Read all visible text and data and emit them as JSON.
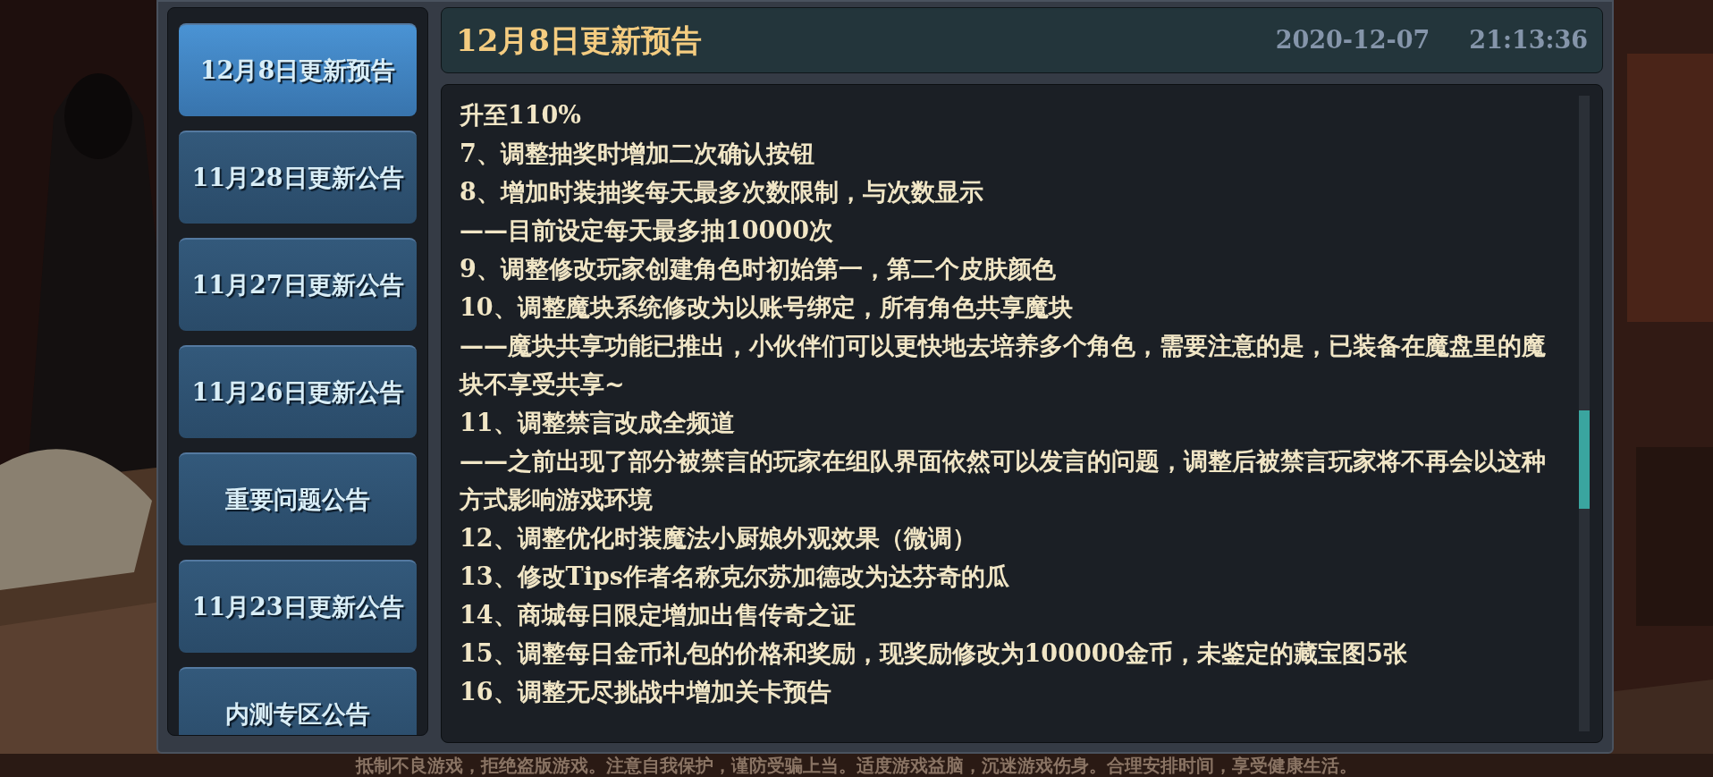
{
  "sidebar": {
    "items": [
      {
        "label": "12月8日更新预告",
        "selected": true
      },
      {
        "label": "11月28日更新公告",
        "selected": false
      },
      {
        "label": "11月27日更新公告",
        "selected": false
      },
      {
        "label": "11月26日更新公告",
        "selected": false
      },
      {
        "label": "重要问题公告",
        "selected": false
      },
      {
        "label": "11月23日更新公告",
        "selected": false
      },
      {
        "label": "内测专区公告",
        "selected": false
      }
    ]
  },
  "header": {
    "title": "12月8日更新预告",
    "date": "2020-12-07",
    "time": "21:13:36"
  },
  "content": {
    "lines": [
      "升至110%",
      "7、调整抽奖时增加二次确认按钮",
      "8、增加时装抽奖每天最多次数限制，与次数显示",
      "——目前设定每天最多抽10000次",
      "9、调整修改玩家创建角色时初始第一，第二个皮肤颜色",
      "10、调整魔块系统修改为以账号绑定，所有角色共享魔块",
      "——魔块共享功能已推出，小伙伴们可以更快地去培养多个角色，需要注意的是，已装备在魔盘里的魔块不享受共享~",
      "11、调整禁言改成全频道",
      "——之前出现了部分被禁言的玩家在组队界面依然可以发言的问题，调整后被禁言玩家将不再会以这种方式影响游戏环境",
      "12、调整优化时装魔法小厨娘外观效果（微调）",
      "13、修改Tips作者名称克尔苏加德改为达芬奇的瓜",
      "14、商城每日限定增加出售传奇之证",
      "15、调整每日金币礼包的价格和奖励，现奖励修改为100000金币，未鉴定的藏宝图5张",
      "16、调整无尽挑战中增加关卡预告"
    ]
  },
  "footer_notice": "抵制不良游戏，拒绝盗版游戏。注意自我保护，谨防受骗上当。适度游戏益脑，沉迷游戏伤身。合理安排时间，享受健康生活。"
}
